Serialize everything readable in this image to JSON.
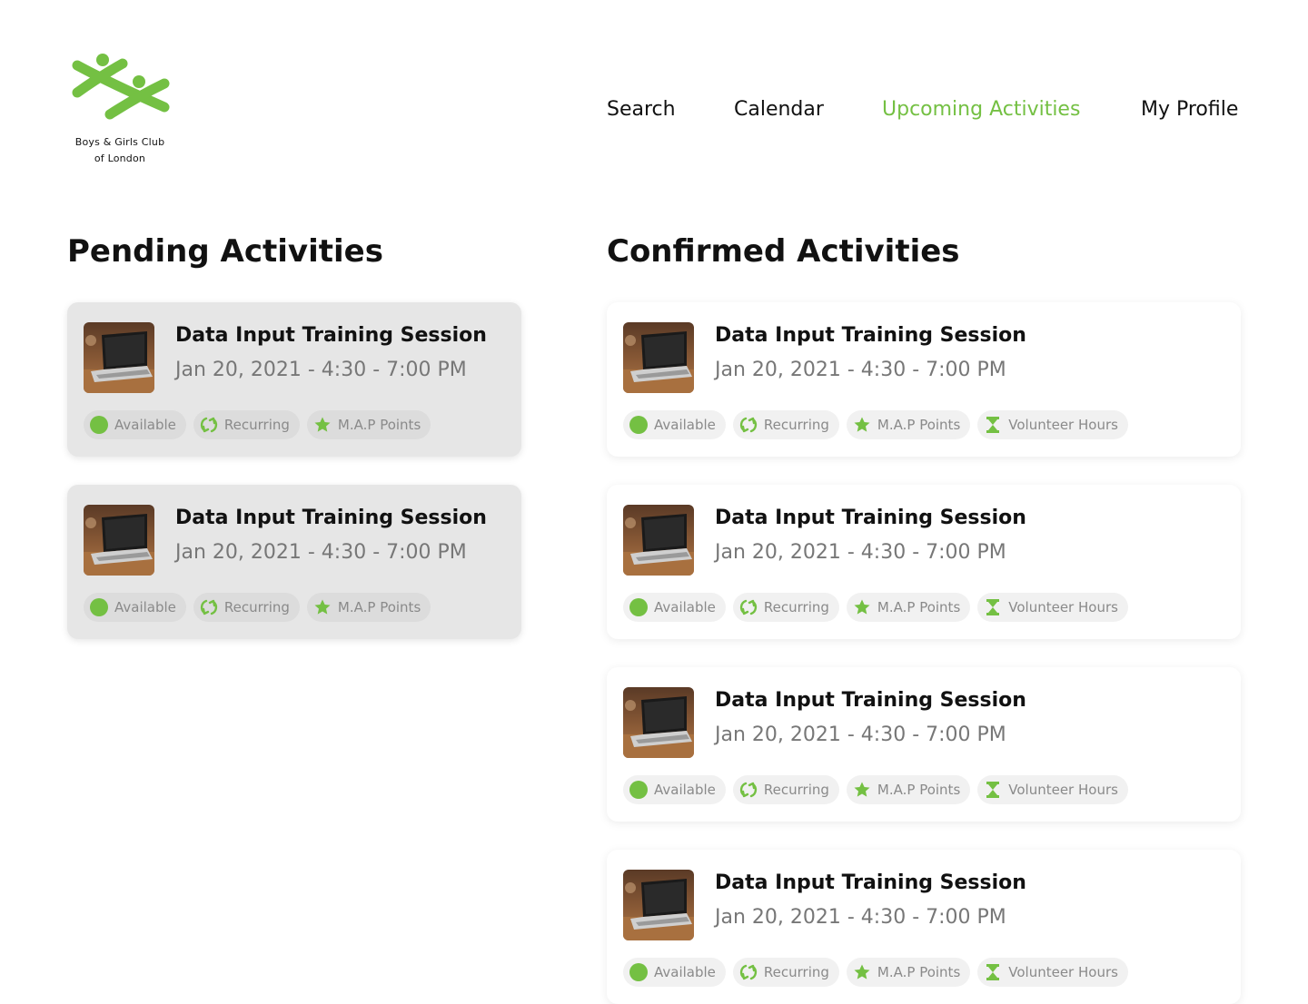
{
  "brand": {
    "name_line1": "Boys & Girls Club",
    "name_line2": "of London",
    "logo_icon": "people-figures-logo",
    "color": "#74c043"
  },
  "nav": {
    "items": [
      {
        "label": "Search",
        "active": false
      },
      {
        "label": "Calendar",
        "active": false
      },
      {
        "label": "Upcoming Activities",
        "active": true
      },
      {
        "label": "My Profile",
        "active": false
      }
    ],
    "active_color": "#74c043"
  },
  "pending": {
    "title": "Pending Activities",
    "cards": [
      {
        "title": "Data Input Training Session",
        "time": "Jan 20, 2021 - 4:30 - 7:00 PM",
        "tags": [
          {
            "icon": "green-dot-icon",
            "label": "Available"
          },
          {
            "icon": "recurring-icon",
            "label": "Recurring"
          },
          {
            "icon": "star-icon",
            "label": "M.A.P Points"
          }
        ]
      },
      {
        "title": "Data Input Training Session",
        "time": "Jan 20, 2021 - 4:30 - 7:00 PM",
        "tags": [
          {
            "icon": "green-dot-icon",
            "label": "Available"
          },
          {
            "icon": "recurring-icon",
            "label": "Recurring"
          },
          {
            "icon": "star-icon",
            "label": "M.A.P Points"
          }
        ]
      }
    ]
  },
  "confirmed": {
    "title": "Confirmed Activities",
    "cards": [
      {
        "title": "Data Input Training Session",
        "time": "Jan 20, 2021 - 4:30 - 7:00 PM",
        "tags": [
          {
            "icon": "green-dot-icon",
            "label": "Available"
          },
          {
            "icon": "recurring-icon",
            "label": "Recurring"
          },
          {
            "icon": "star-icon",
            "label": "M.A.P Points"
          },
          {
            "icon": "hourglass-icon",
            "label": "Volunteer Hours"
          }
        ]
      },
      {
        "title": "Data Input Training Session",
        "time": "Jan 20, 2021 - 4:30 - 7:00 PM",
        "tags": [
          {
            "icon": "green-dot-icon",
            "label": "Available"
          },
          {
            "icon": "recurring-icon",
            "label": "Recurring"
          },
          {
            "icon": "star-icon",
            "label": "M.A.P Points"
          },
          {
            "icon": "hourglass-icon",
            "label": "Volunteer Hours"
          }
        ]
      },
      {
        "title": "Data Input Training Session",
        "time": "Jan 20, 2021 - 4:30 - 7:00 PM",
        "tags": [
          {
            "icon": "green-dot-icon",
            "label": "Available"
          },
          {
            "icon": "recurring-icon",
            "label": "Recurring"
          },
          {
            "icon": "star-icon",
            "label": "M.A.P Points"
          },
          {
            "icon": "hourglass-icon",
            "label": "Volunteer Hours"
          }
        ]
      },
      {
        "title": "Data Input Training Session",
        "time": "Jan 20, 2021 - 4:30 - 7:00 PM",
        "tags": [
          {
            "icon": "green-dot-icon",
            "label": "Available"
          },
          {
            "icon": "recurring-icon",
            "label": "Recurring"
          },
          {
            "icon": "star-icon",
            "label": "M.A.P Points"
          },
          {
            "icon": "hourglass-icon",
            "label": "Volunteer Hours"
          }
        ]
      }
    ]
  }
}
